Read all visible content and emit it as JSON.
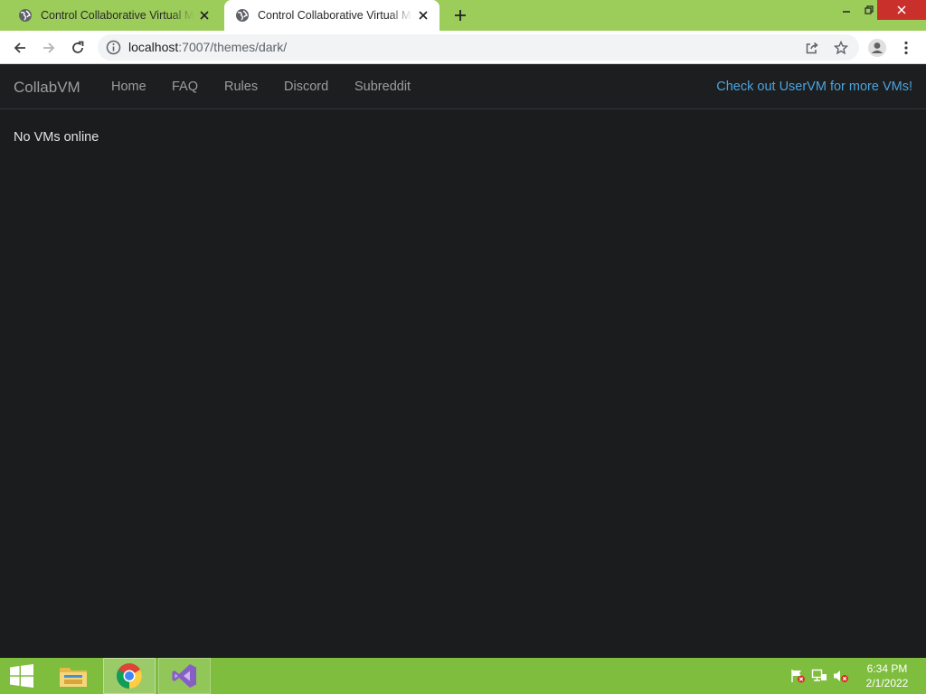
{
  "browser": {
    "tabs": [
      {
        "title": "Control Collaborative Virtual Machines",
        "active": false
      },
      {
        "title": "Control Collaborative Virtual Machines",
        "active": true
      }
    ],
    "url_host": "localhost",
    "url_rest": ":7007/themes/dark/"
  },
  "page": {
    "brand": "CollabVM",
    "nav": [
      "Home",
      "FAQ",
      "Rules",
      "Discord",
      "Subreddit"
    ],
    "promo": "Check out UserVM for more VMs!",
    "status": "No VMs online"
  },
  "taskbar": {
    "time": "6:34 PM",
    "date": "2/1/2022"
  },
  "colors": {
    "chrome_frame": "#9ccc5a",
    "page_bg": "#1b1c1e",
    "link_accent": "#4aa3df",
    "taskbar": "#7fbd3e"
  }
}
